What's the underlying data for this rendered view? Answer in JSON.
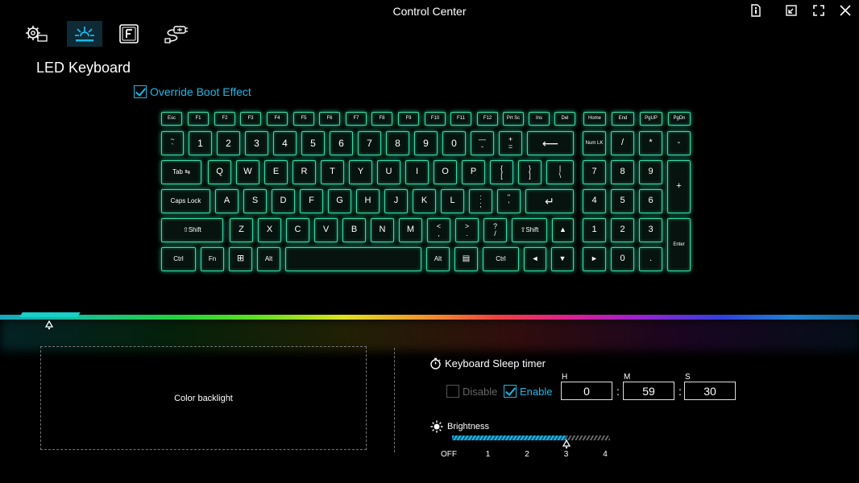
{
  "window": {
    "title": "Control Center"
  },
  "window_buttons": [
    {
      "name": "info-icon"
    },
    {
      "name": "minimize-icon"
    },
    {
      "name": "maximize-icon"
    },
    {
      "name": "close-icon"
    }
  ],
  "nav_tabs": [
    {
      "name": "system-settings-icon",
      "active": false
    },
    {
      "name": "led-keyboard-icon",
      "active": true
    },
    {
      "name": "function-key-icon",
      "active": false
    },
    {
      "name": "power-plug-icon",
      "active": false
    }
  ],
  "section": {
    "title": "LED Keyboard"
  },
  "override_boot": {
    "label": "Override Boot Effect",
    "checked": true
  },
  "keyboard": {
    "glow_color": "#2fe0a8",
    "rows": [
      [
        "Esc",
        "F1",
        "F2",
        "F3",
        "F4",
        "F5",
        "F6",
        "F7",
        "F8",
        "F9",
        "F10",
        "F11",
        "F12",
        "Prt Sc",
        "Ins",
        "Del"
      ],
      [
        "~\n`",
        "1",
        "2",
        "3",
        "4",
        "5",
        "6",
        "7",
        "8",
        "9",
        "0",
        "—\n-",
        "+\n=",
        "⟵"
      ],
      [
        "Tab ⇆",
        "Q",
        "W",
        "E",
        "R",
        "T",
        "Y",
        "U",
        "I",
        "O",
        "P",
        "{\n[",
        "}\n]",
        "|\n\\"
      ],
      [
        "Caps Lock",
        "A",
        "S",
        "D",
        "F",
        "G",
        "H",
        "J",
        "K",
        "L",
        ":\n;",
        "\"\n'",
        "↵"
      ],
      [
        "⇧Shift",
        "Z",
        "X",
        "C",
        "V",
        "B",
        "N",
        "M",
        "<\n,",
        ">\n.",
        "?\n/",
        "⇧Shift",
        "▲"
      ],
      [
        "Ctrl",
        "Fn",
        "⊞",
        "Alt",
        "",
        "Alt",
        "▤",
        "Ctrl",
        "◄",
        "▼",
        "►"
      ]
    ],
    "nav_keys": [
      "Home",
      "End",
      "PgUP",
      "PgDn"
    ],
    "numpad": [
      "Num LK",
      "/",
      "*",
      "-",
      "7",
      "8",
      "9",
      "+",
      "4",
      "5",
      "6",
      "1",
      "2",
      "3",
      "Enter",
      "0",
      "."
    ]
  },
  "color_panel": {
    "label": "Color backlight"
  },
  "sleep_timer": {
    "title": "Keyboard Sleep timer",
    "disable_label": "Disable",
    "disable_checked": false,
    "enable_label": "Enable",
    "enable_checked": true,
    "h_label": "H",
    "m_label": "M",
    "s_label": "S",
    "hours": "0",
    "minutes": "59",
    "seconds": "30",
    "colon": ":"
  },
  "brightness": {
    "title": "Brightness",
    "levels": [
      "OFF",
      "1",
      "2",
      "3",
      "4"
    ],
    "value_index": 3,
    "accent": "#19b8e8"
  },
  "colors": {
    "accent": "#1bb8e8",
    "background": "#000000"
  }
}
